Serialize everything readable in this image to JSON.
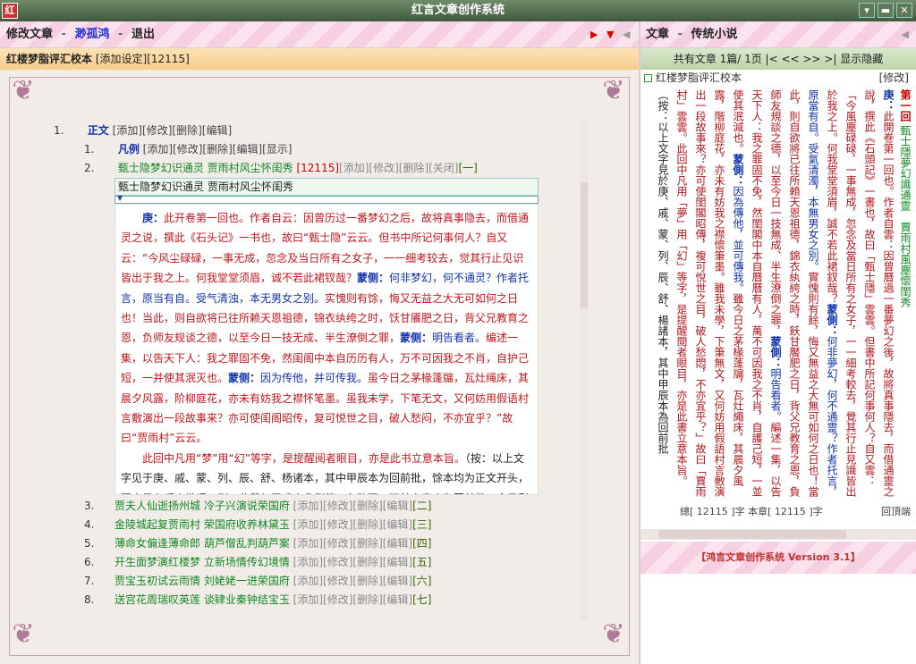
{
  "window": {
    "title": "红言文章创作系统",
    "icon": "红"
  },
  "left_header": {
    "modify": "修改文章",
    "dash1": "-",
    "author": "渺孤鸿",
    "dash2": "-",
    "exit": "退出"
  },
  "left_sub": {
    "title": "红楼梦脂评汇校本",
    "add_setting": "[添加设定]",
    "count": "[12115]"
  },
  "right_header": {
    "label": "文章",
    "dash": "-",
    "category": "传统小说"
  },
  "right_sub": {
    "text": "共有文章 1篇/ 1页 |< << >> >| 显示隐藏"
  },
  "tree": {
    "root": {
      "num": "1.",
      "label": "正文",
      "actions": "[添加][修改][删除][编辑]"
    },
    "fanli": {
      "num": "1.",
      "label": "凡例",
      "actions": "[添加][修改][删除][编辑][显示]"
    },
    "ch2": {
      "num": "2.",
      "label": "甄士隐梦幻识通灵 贾雨村风尘怀闺秀",
      "count": "[12115]",
      "actions": "[添加][修改][删除][关闭]",
      "tag": "[一]"
    },
    "edit_title": "甄士隐梦幻识通灵 贾雨村风尘怀闺秀",
    "chapters": [
      {
        "num": "3.",
        "label": "贾夫人仙逝扬州城 冷子兴演说荣国府",
        "actions": "[添加][修改][删除][编辑]",
        "tag": "[二]"
      },
      {
        "num": "4.",
        "label": "金陵城起复贾雨村 荣国府收养林黛玉",
        "actions": "[添加][修改][删除][编辑]",
        "tag": "[三]"
      },
      {
        "num": "5.",
        "label": "薄命女偏逢薄命郎 葫芦僧乱判葫芦案",
        "actions": "[添加][修改][删除][编辑]",
        "tag": "[四]"
      },
      {
        "num": "6.",
        "label": "开生面梦演红楼梦 立新场情传幻境情",
        "actions": "[添加][修改][删除][编辑]",
        "tag": "[五]"
      },
      {
        "num": "7.",
        "label": "贾宝玉初试云雨情 刘姥姥一进荣国府",
        "actions": "[添加][修改][删除][编辑]",
        "tag": "[六]"
      },
      {
        "num": "8.",
        "label": "送宫花周瑞叹英莲 谈肄业秦钟结宝玉",
        "actions": "[添加][修改][删除][编辑]",
        "tag": "[七]"
      }
    ]
  },
  "preview": {
    "p1": [
      {
        "c": "k",
        "t": "庚："
      },
      {
        "c": "r",
        "t": "此开卷第一回也。作者自云：因曾历过一番梦幻之后，故将真事隐去，而借通灵之说，撰此《石头记》一书也，故曰“甄士隐”云云。但书中所记何事何人？自又云：“今风尘碌碌，一事无成，忽念及当日所有之女子，一一细考较去，觉其行止见识皆出于我之上。何我堂堂须眉，诚不若此裙钗哉？"
      },
      {
        "c": "k",
        "t": "蒙侧："
      },
      {
        "c": "b",
        "t": "何非梦幻，何不通灵？作者托言，原当有自。受气清浊，本无男女之别。"
      },
      {
        "c": "r",
        "t": "实愧则有馀，悔又无益之大无可如何之日也！当此，则自欲将已往所赖天恩祖德，锦衣纨绔之时，饫甘餍肥之日，背父兄教育之恩，负师友规谈之德，以至今日一技无成、半生潦倒之罪，"
      },
      {
        "c": "k",
        "t": "蒙侧："
      },
      {
        "c": "b",
        "t": "明告看者。"
      },
      {
        "c": "r",
        "t": "编述一集，以告天下人：我之罪固不免，然闺阁中本自历历有人，万不可因我之不肖，自护己短，一并使其泯灭也。"
      },
      {
        "c": "k",
        "t": "蒙侧："
      },
      {
        "c": "b",
        "t": "因为传他，并可传我。"
      },
      {
        "c": "r",
        "t": "虽今日之茅椽蓬牖，瓦灶绳床，其晨夕风露，阶柳庭花，亦未有妨我之襟怀笔墨。虽我未学，下笔无文，又何妨用假语村言敷演出一段故事来？亦可使闺阁昭传，复可悦世之目，破人愁闷，不亦宜乎？”故曰“贾雨村”云云。"
      }
    ],
    "p2": [
      {
        "c": "r",
        "t": "此回中凡用“梦”用“幻”等字，是提醒阅者眼目，亦是此书立意本旨。"
      },
      {
        "c": "n",
        "t": "（按：以上文字见于庚、戚、蒙、列、辰、舒、杨诸本，其中甲辰本为回前批，馀本均为正文开头，蒙本另有后人批语三则。此段与甲戌本凡例第五条略同，玩其文意应为回前批。今予剔出，正文开始仍依甲本。）"
      }
    ]
  },
  "right_panel": {
    "title": "红楼梦脂评汇校本",
    "modify": "[修改]",
    "heading": {
      "hui": "第一回",
      "title": "甄士隱夢幻識通靈　賈雨村風塵懷閨秀"
    },
    "vertical": [
      {
        "c": "k",
        "t": "庚："
      },
      {
        "c": "r",
        "t": "此開卷第一回也。作者自雲：因曾曆過一番夢幻之後，故將真事隱去，而借通靈之說，撰此《石頭記》一書也，故曰「甄士隱」雲雲。但書中所記何事何人？自又雲：「今風塵碌碌，一事無成，忽念及當日所有之女子，一一細考較去，覺其行止見識皆出於我之上。何我堂堂須眉，誠不若此裙釵哉？"
      },
      {
        "c": "k",
        "t": "蒙側："
      },
      {
        "c": "b",
        "t": "何非夢幻，何不通靈？作者托言，原當有自。受氣清濁，本無男女之別。"
      },
      {
        "c": "r",
        "t": "實愧則有餘，悔又無益之大無可如何之日也！當此，則自欲將已往所賴天恩祖德，錦衣紈絝之時，飫甘饜肥之日，背父兄教育之恩，負師友規談之德，以至今日一技無成、半生潦倒之罪，"
      },
      {
        "c": "k",
        "t": "蒙側："
      },
      {
        "c": "b",
        "t": "明告看者。"
      },
      {
        "c": "r",
        "t": "編述一集，以告天下人：我之罪固不免，然閨閣中本自曆曆有人，萬不可因我之不肖，自護己短，一並使其泯滅也。"
      },
      {
        "c": "k",
        "t": "蒙側："
      },
      {
        "c": "b",
        "t": "因為傳他，並可傳我。"
      },
      {
        "c": "r",
        "t": "雖今日之茅椽蓬牖，瓦灶繩床，其晨夕風露，階柳庭花，亦未有妨我之襟懷筆墨。雖我未學，下筆無文，又何妨用假語村言敷演出一段故事來？亦可使閨閣昭傳，複可悅世之目，破人愁悶，不亦宜乎？」故曰「賈雨村」雲雲。此回中凡用「夢」用「幻」等字，是提醒閱者眼目，亦是此書立意本旨。"
      },
      {
        "c": "n",
        "t": "（按：以上文字見於庚、戚、蒙、列、辰、舒、楊諸本，其中甲辰本為回前批"
      }
    ],
    "stat": "總[ 12115 ]字 本章[ 12115 ]字",
    "back": "回頂端",
    "footer": "【鸿言文章创作系统 Version 3.1】"
  },
  "colors": {
    "accent_red": "#c0161d",
    "comment_blue": "#1033aa",
    "chapter_green": "#118822"
  },
  "icons": {
    "app": "app-icon",
    "minimize": "minimize-icon",
    "maximize": "maximize-icon",
    "close": "close-icon",
    "nav_right": "triangle-right-icon",
    "nav_down": "triangle-down-icon"
  }
}
